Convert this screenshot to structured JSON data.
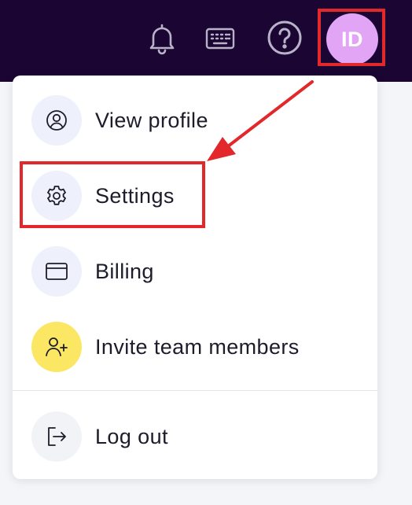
{
  "topbar": {
    "icons": [
      "bell-icon",
      "keyboard-icon",
      "help-icon"
    ],
    "avatar_initials": "ID"
  },
  "menu": {
    "items": [
      {
        "label": "View profile",
        "icon": "user-circle-icon"
      },
      {
        "label": "Settings",
        "icon": "gear-icon"
      },
      {
        "label": "Billing",
        "icon": "credit-card-icon"
      },
      {
        "label": "Invite team members",
        "icon": "user-plus-icon"
      },
      {
        "label": "Log out",
        "icon": "logout-icon"
      }
    ]
  },
  "colors": {
    "topbar_bg": "#1b0633",
    "avatar_bg": "#e2a4f5",
    "annotation_red": "#e2282a",
    "icon_circle_bg": "#eef0fb",
    "invite_circle_bg": "#fbe764"
  }
}
